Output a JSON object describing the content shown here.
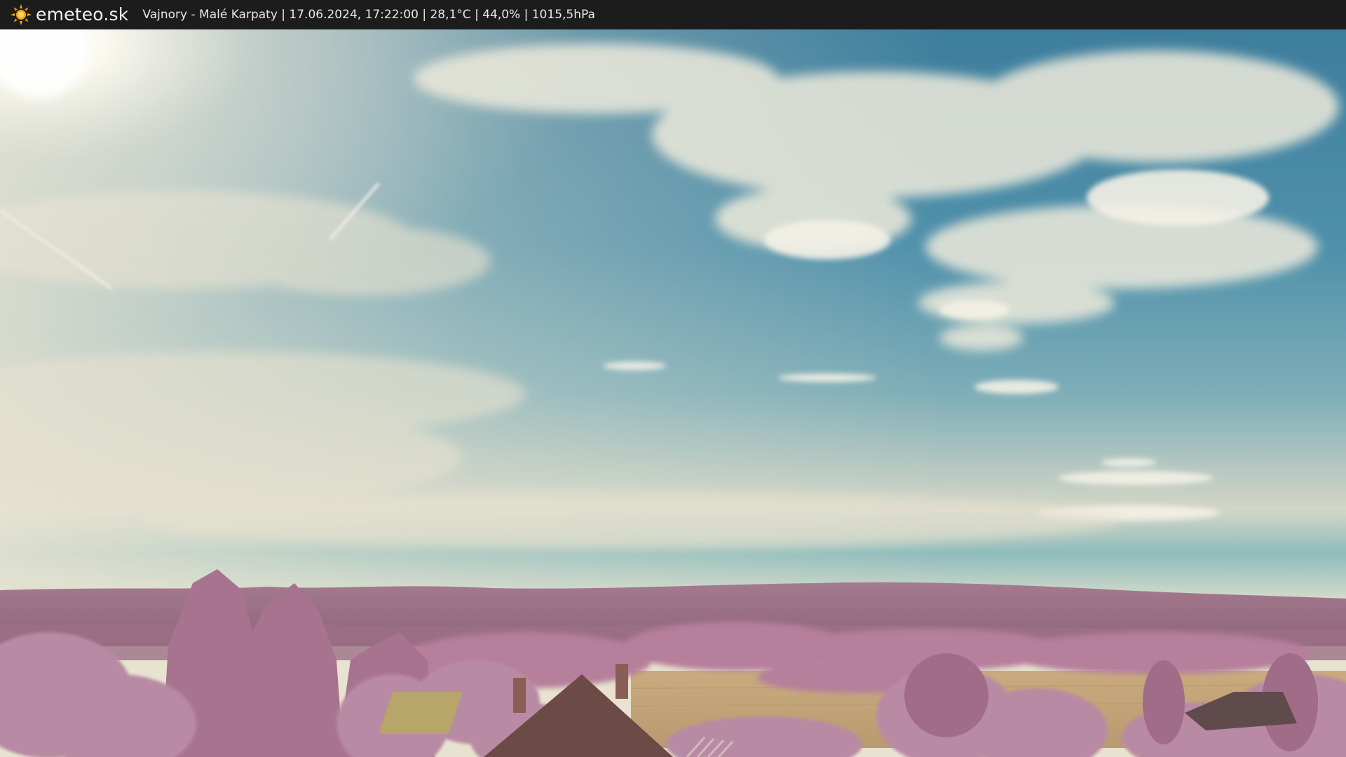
{
  "header": {
    "brand": "emeteo.sk",
    "logo_icon": "sun-icon",
    "caption": "Vajnory - Malé Karpaty | 17.06.2024, 17:22:00 | 28,1°C | 44,0% | 1015,5hPa"
  },
  "colors": {
    "bar_background": "#1c1c1c",
    "sun": "#f6a21a",
    "sky_top": "#4d8aa6",
    "sky_horizon": "#e6e1cf",
    "foliage": "#b07a98",
    "field": "#c8a878"
  }
}
